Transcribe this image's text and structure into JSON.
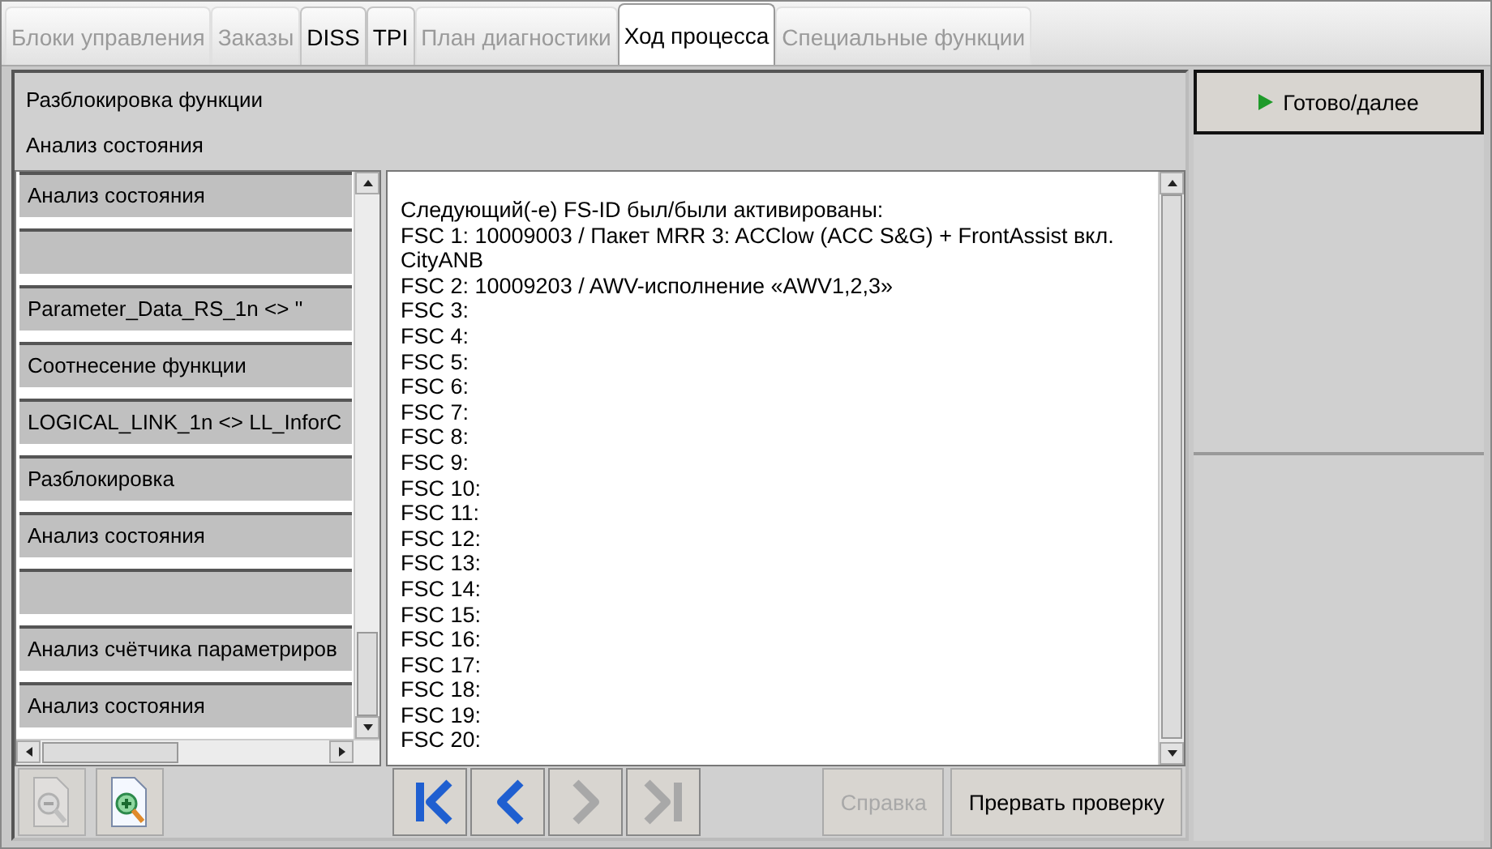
{
  "tabs": [
    {
      "label": "Блоки управления",
      "disabled": true,
      "selected": false
    },
    {
      "label": "Заказы",
      "disabled": true,
      "selected": false
    },
    {
      "label": "DISS",
      "disabled": false,
      "selected": false
    },
    {
      "label": "TPI",
      "disabled": false,
      "selected": false
    },
    {
      "label": "План диагностики",
      "disabled": true,
      "selected": false
    },
    {
      "label": "Ход процесса",
      "disabled": false,
      "selected": true
    },
    {
      "label": "Специальные функции",
      "disabled": true,
      "selected": false
    }
  ],
  "header": {
    "title": "Разблокировка функции",
    "subtitle": "Анализ состояния"
  },
  "steps": [
    {
      "kind": "text",
      "label": "Анализ состояния"
    },
    {
      "kind": "blank"
    },
    {
      "kind": "text",
      "label": "Parameter_Data_RS_1n <> ''"
    },
    {
      "kind": "text",
      "label": "Соотнесение функции"
    },
    {
      "kind": "text",
      "label": "LOGICAL_LINK_1n <> LL_InforC"
    },
    {
      "kind": "text",
      "label": "Разблокировка"
    },
    {
      "kind": "text",
      "label": "Анализ состояния"
    },
    {
      "kind": "blank"
    },
    {
      "kind": "text",
      "label": "Анализ счётчика параметриров"
    },
    {
      "kind": "text",
      "label": "Анализ состояния"
    }
  ],
  "output_lines": [
    "Следующий(-е) FS-ID был/были активированы:",
    "FSC 1: 10009003 / Пакет MRR 3: ACClow (ACC S&G) + FrontAssist вкл.",
    "CityANB",
    "FSC 2: 10009203 / AWV-исполнение «AWV1,2,3»",
    "FSC 3:",
    "FSC 4:",
    "FSC 5:",
    "FSC 6:",
    "FSC 7:",
    "FSC 8:",
    "FSC 9:",
    "FSC 10:",
    "FSC 11:",
    "FSC 12:",
    "FSC 13:",
    "FSC 14:",
    "FSC 15:",
    "FSC 16:",
    "FSC 17:",
    "FSC 18:",
    "FSC 19:",
    "FSC 20:"
  ],
  "zoom_buttons": [
    {
      "kind": "zoom-out",
      "disabled": true
    },
    {
      "kind": "zoom-in",
      "disabled": false
    }
  ],
  "nav_buttons": [
    {
      "kind": "first",
      "disabled": false
    },
    {
      "kind": "previous",
      "disabled": false
    },
    {
      "kind": "next",
      "disabled": true
    },
    {
      "kind": "last",
      "disabled": true
    }
  ],
  "action_buttons": [
    {
      "label": "Справка",
      "disabled": true
    },
    {
      "label": "Прервать проверку",
      "disabled": false
    }
  ],
  "next_button": {
    "label": "Готово/далее"
  }
}
